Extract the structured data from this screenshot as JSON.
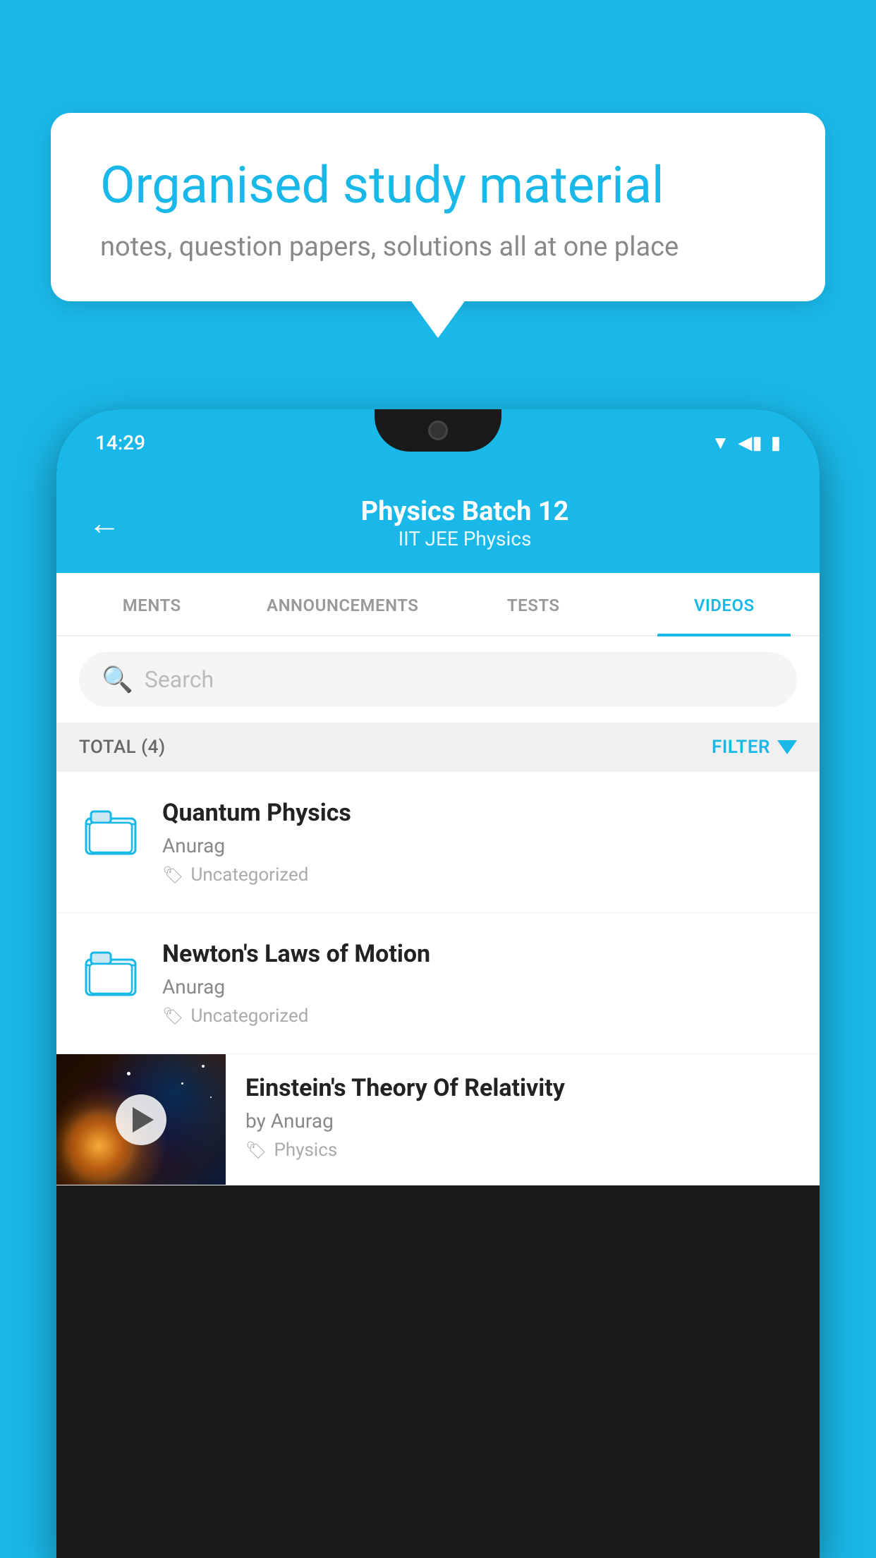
{
  "background_color": "#1ab8e8",
  "speech_bubble": {
    "title": "Organised study material",
    "subtitle": "notes, question papers, solutions all at one place"
  },
  "phone": {
    "status_bar": {
      "time": "14:29"
    },
    "app_header": {
      "back_label": "←",
      "batch_title": "Physics Batch 12",
      "batch_subtitle": "IIT JEE   Physics"
    },
    "tabs": [
      {
        "label": "MENTS",
        "active": false
      },
      {
        "label": "ANNOUNCEMENTS",
        "active": false
      },
      {
        "label": "TESTS",
        "active": false
      },
      {
        "label": "VIDEOS",
        "active": true
      }
    ],
    "search": {
      "placeholder": "Search"
    },
    "filter_bar": {
      "total_label": "TOTAL (4)",
      "filter_label": "FILTER"
    },
    "videos": [
      {
        "type": "folder",
        "title": "Quantum Physics",
        "author": "Anurag",
        "tag": "Uncategorized"
      },
      {
        "type": "folder",
        "title": "Newton's Laws of Motion",
        "author": "Anurag",
        "tag": "Uncategorized"
      },
      {
        "type": "video",
        "title": "Einstein's Theory Of Relativity",
        "author": "by Anurag",
        "tag": "Physics"
      }
    ]
  }
}
